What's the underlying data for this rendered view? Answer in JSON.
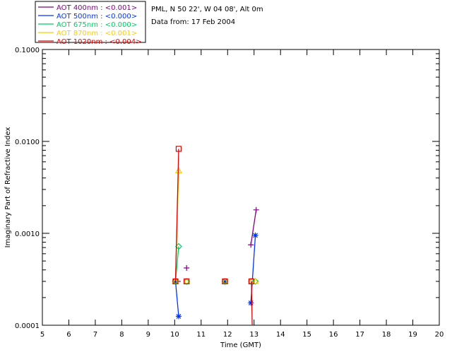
{
  "chart_data": {
    "type": "line",
    "header": {
      "location": "PML, N 50 22', W 04 08', Alt 0m",
      "date": "Data from: 17 Feb 2004"
    },
    "xlabel": "Time (GMT)",
    "ylabel": "Imaginary Part of Refractive Index",
    "xlim": [
      5,
      20
    ],
    "ylim": [
      0.0001,
      0.1
    ],
    "yscale": "log",
    "x_ticks": [
      "5",
      "6",
      "7",
      "8",
      "9",
      "10",
      "11",
      "12",
      "13",
      "14",
      "15",
      "16",
      "17",
      "18",
      "19",
      "20"
    ],
    "y_ticks": [
      {
        "value": 0.1,
        "label": "0.1000"
      },
      {
        "value": 0.01,
        "label": "0.0100"
      },
      {
        "value": 0.001,
        "label": "0.0010"
      },
      {
        "value": 0.0001,
        "label": "0.0001"
      }
    ],
    "grid": false,
    "legend_position": "top-left",
    "series": [
      {
        "name": "AOT  400nm : <0.001>",
        "color": "#7f007f",
        "marker": "plus",
        "curves": [
          [
            [
              10.03,
              0.0003
            ],
            [
              10.12,
              0.0003
            ]
          ],
          [
            [
              12.88,
              0.00075
            ],
            [
              13.08,
              0.0018
            ]
          ]
        ],
        "points": [
          [
            10.03,
            0.0003
          ],
          [
            10.12,
            0.0003
          ],
          [
            10.45,
            0.00042
          ],
          [
            11.9,
            0.0003
          ],
          [
            12.88,
            0.00075
          ],
          [
            13.08,
            0.0018
          ]
        ]
      },
      {
        "name": "AOT  500nm : <0.000>",
        "color": "#0033ff",
        "marker": "asterisk",
        "curves": [
          [
            [
              10.03,
              0.0003
            ],
            [
              10.15,
              0.000125
            ]
          ],
          [
            [
              12.88,
              0.000175
            ],
            [
              13.05,
              0.00095
            ]
          ]
        ],
        "points": [
          [
            10.03,
            0.0003
          ],
          [
            10.15,
            0.000125
          ],
          [
            11.9,
            0.0003
          ],
          [
            12.88,
            0.000175
          ],
          [
            13.05,
            0.00095
          ]
        ]
      },
      {
        "name": "AOT  675nm : <0.000>",
        "color": "#00cc66",
        "marker": "diamond",
        "curves": [
          [
            [
              10.03,
              0.0003
            ],
            [
              10.15,
              0.00072
            ]
          ]
        ],
        "points": [
          [
            10.03,
            0.0003
          ],
          [
            10.15,
            0.00072
          ],
          [
            10.45,
            0.0003
          ],
          [
            11.9,
            0.0003
          ],
          [
            12.9,
            0.0003
          ],
          [
            13.05,
            0.0003
          ]
        ]
      },
      {
        "name": "AOT  870nm : <0.001>",
        "color": "#ffcc00",
        "marker": "triangle",
        "curves": [
          [
            [
              10.03,
              0.0003
            ],
            [
              10.15,
              0.0048
            ]
          ]
        ],
        "points": [
          [
            10.03,
            0.0003
          ],
          [
            10.15,
            0.0048
          ],
          [
            10.45,
            0.0003
          ],
          [
            11.9,
            0.0003
          ],
          [
            12.9,
            0.0003
          ],
          [
            13.05,
            0.0003
          ]
        ]
      },
      {
        "name": "AOT 1020nm : <0.004>",
        "color": "#dd0000",
        "marker": "square",
        "curves": [
          [
            [
              10.03,
              0.0003
            ],
            [
              10.15,
              0.0083
            ]
          ],
          [
            [
              12.9,
              0.0003
            ],
            [
              12.93,
              0.0001
            ]
          ]
        ],
        "points": [
          [
            10.03,
            0.0003
          ],
          [
            10.15,
            0.0083
          ],
          [
            10.45,
            0.0003
          ],
          [
            11.9,
            0.0003
          ],
          [
            12.9,
            0.0003
          ]
        ]
      }
    ]
  }
}
